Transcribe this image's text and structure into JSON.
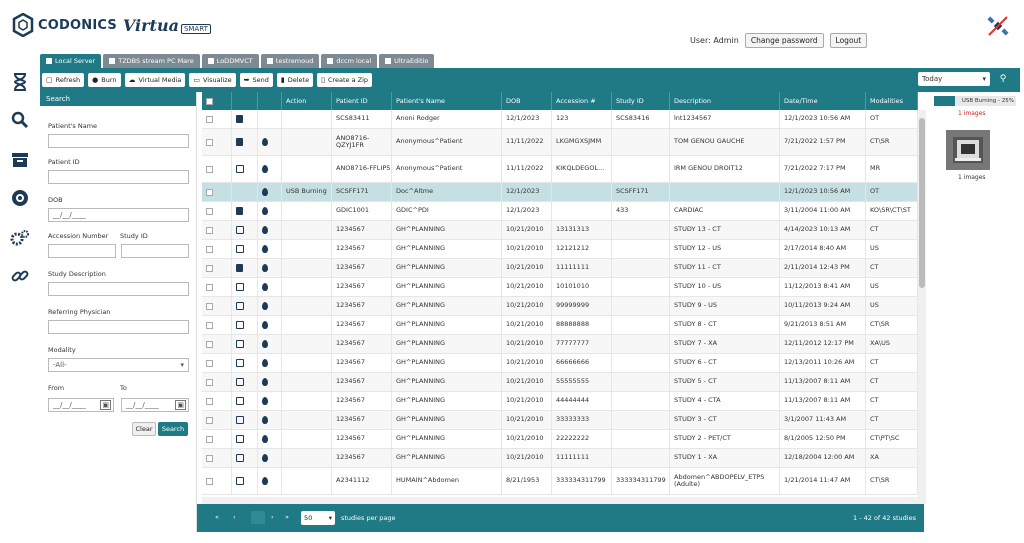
{
  "app": {
    "brand": "CODONICS",
    "product": "Virtua",
    "edition": "SMART"
  },
  "header": {
    "user_label": "User: Admin",
    "change_password": "Change password",
    "logout": "Logout"
  },
  "tabs": [
    {
      "label": "Local Server",
      "active": true
    },
    {
      "label": "TZDBS stream PC Mare",
      "active": false
    },
    {
      "label": "LoDDMVCT",
      "active": false
    },
    {
      "label": "testremoud",
      "active": false
    },
    {
      "label": "dccm local",
      "active": false
    },
    {
      "label": "UltraEditio",
      "active": false
    }
  ],
  "toolbar": {
    "refresh": "Refresh",
    "burn": "Burn",
    "virtual_media": "Virtual Media",
    "visualize": "Visualize",
    "send": "Send",
    "delete": "Delete",
    "create_zip": "Create a Zip",
    "date_filter": "Today"
  },
  "search": {
    "heading": "Search",
    "patient_name_label": "Patient's Name",
    "patient_id_label": "Patient ID",
    "dob_label": "DOB",
    "dob_value": "__/__/____",
    "accession_label": "Accession Number",
    "study_id_label": "Study ID",
    "study_desc_label": "Study Description",
    "ref_phys_label": "Referring Physician",
    "modality_label": "Modality",
    "modality_value": "-All-",
    "from_label": "From",
    "to_label": "To",
    "from_value": "__/__/____",
    "to_value": "__/__/____",
    "clear": "Clear",
    "search_btn": "Search"
  },
  "grid": {
    "columns": [
      "",
      "",
      "",
      "Action",
      "Patient ID",
      "Patient's Name",
      "DOB",
      "Accession #",
      "Study ID",
      "Description",
      "Date/Time",
      "Modalities"
    ],
    "rows": [
      {
        "icon": "doc",
        "drop": false,
        "action": "",
        "pid": "SCS83411",
        "name": "Anoni Rodger",
        "dob": "12/1/2023",
        "acc": "123",
        "sid": "SCS83416",
        "desc": "lnt1234567",
        "dt": "12/1/2023 10:56 AM",
        "mod": "OT"
      },
      {
        "icon": "doc",
        "drop": true,
        "action": "",
        "pid": "ANO8716-QZYJ1FR",
        "name": "Anonymous^Patient",
        "dob": "11/11/2022",
        "acc": "LKGMGXSJMM",
        "sid": "",
        "desc": "TOM GENOU GAUCHE",
        "dt": "7/21/2022 1:57 PM",
        "mod": "CT\\SR"
      },
      {
        "icon": "edit",
        "drop": true,
        "action": "",
        "pid": "ANO8716-FFLIP5",
        "name": "Anonymous^Patient",
        "dob": "11/11/2022",
        "acc": "KIKQLDEGOL...",
        "sid": "",
        "desc": "IRM GENOU DROIT12",
        "dt": "7/21/2022 7:17 PM",
        "mod": "MR"
      },
      {
        "icon": "none",
        "drop": true,
        "action": "USB Burning",
        "pid": "SCSFF171",
        "name": "Doc^Altme",
        "dob": "12/1/2023",
        "acc": "",
        "sid": "SCSFF171",
        "desc": "",
        "dt": "12/1/2023 10:56 AM",
        "mod": "OT",
        "selected": true
      },
      {
        "icon": "check",
        "drop": true,
        "action": "",
        "pid": "GDIC1001",
        "name": "GDIC^PDI",
        "dob": "12/1/2023",
        "acc": "",
        "sid": "433",
        "desc": "CARDIAC",
        "dt": "3/11/2004 11:00 AM",
        "mod": "KO\\SR\\CT\\ST"
      },
      {
        "icon": "edit",
        "drop": true,
        "action": "",
        "pid": "1234567",
        "name": "GH^PLANNING",
        "dob": "10/21/2010",
        "acc": "13131313",
        "sid": "",
        "desc": "STUDY 13 - CT",
        "dt": "4/14/2023 10:13 AM",
        "mod": "CT"
      },
      {
        "icon": "edit",
        "drop": true,
        "action": "",
        "pid": "1234567",
        "name": "GH^PLANNING",
        "dob": "10/21/2010",
        "acc": "12121212",
        "sid": "",
        "desc": "STUDY 12 - US",
        "dt": "2/17/2014 8:40 AM",
        "mod": "US"
      },
      {
        "icon": "check",
        "drop": true,
        "action": "",
        "pid": "1234567",
        "name": "GH^PLANNING",
        "dob": "10/21/2010",
        "acc": "11111111",
        "sid": "",
        "desc": "STUDY 11 - CT",
        "dt": "2/11/2014 12:43 PM",
        "mod": "CT"
      },
      {
        "icon": "edit",
        "drop": true,
        "action": "",
        "pid": "1234567",
        "name": "GH^PLANNING",
        "dob": "10/21/2010",
        "acc": "10101010",
        "sid": "",
        "desc": "STUDY 10 - US",
        "dt": "11/12/2013 8:41 AM",
        "mod": "US"
      },
      {
        "icon": "edit",
        "drop": true,
        "action": "",
        "pid": "1234567",
        "name": "GH^PLANNING",
        "dob": "10/21/2010",
        "acc": "99999999",
        "sid": "",
        "desc": "STUDY 9 - US",
        "dt": "10/11/2013 9:24 AM",
        "mod": "US"
      },
      {
        "icon": "edit",
        "drop": true,
        "action": "",
        "pid": "1234567",
        "name": "GH^PLANNING",
        "dob": "10/21/2010",
        "acc": "88888888",
        "sid": "",
        "desc": "STUDY 8 - CT",
        "dt": "9/21/2013 8:51 AM",
        "mod": "CT\\SR"
      },
      {
        "icon": "edit",
        "drop": true,
        "action": "",
        "pid": "1234567",
        "name": "GH^PLANNING",
        "dob": "10/21/2010",
        "acc": "77777777",
        "sid": "",
        "desc": "STUDY 7 - XA",
        "dt": "12/11/2012 12:17 PM",
        "mod": "XA\\US"
      },
      {
        "icon": "edit",
        "drop": true,
        "action": "",
        "pid": "1234567",
        "name": "GH^PLANNING",
        "dob": "10/21/2010",
        "acc": "66666666",
        "sid": "",
        "desc": "STUDY 6 - CT",
        "dt": "12/13/2011 10:26 AM",
        "mod": "CT"
      },
      {
        "icon": "edit",
        "drop": true,
        "action": "",
        "pid": "1234567",
        "name": "GH^PLANNING",
        "dob": "10/21/2010",
        "acc": "55555555",
        "sid": "",
        "desc": "STUDY 5 - CT",
        "dt": "11/13/2007 8:11 AM",
        "mod": "CT"
      },
      {
        "icon": "edit",
        "drop": true,
        "action": "",
        "pid": "1234567",
        "name": "GH^PLANNING",
        "dob": "10/21/2010",
        "acc": "44444444",
        "sid": "",
        "desc": "STUDY 4 - CTA",
        "dt": "11/13/2007 8:11 AM",
        "mod": "CT"
      },
      {
        "icon": "edit",
        "drop": true,
        "action": "",
        "pid": "1234567",
        "name": "GH^PLANNING",
        "dob": "10/21/2010",
        "acc": "33333333",
        "sid": "",
        "desc": "STUDY 3 - CT",
        "dt": "3/1/2007 11:43 AM",
        "mod": "CT"
      },
      {
        "icon": "edit",
        "drop": true,
        "action": "",
        "pid": "1234567",
        "name": "GH^PLANNING",
        "dob": "10/21/2010",
        "acc": "22222222",
        "sid": "",
        "desc": "STUDY 2 - PET/CT",
        "dt": "8/1/2005 12:50 PM",
        "mod": "CT\\PT\\SC"
      },
      {
        "icon": "edit",
        "drop": true,
        "action": "",
        "pid": "1234567",
        "name": "GH^PLANNING",
        "dob": "10/21/2010",
        "acc": "11111111",
        "sid": "",
        "desc": "STUDY 1 - XA",
        "dt": "12/18/2004 12:00 AM",
        "mod": "XA"
      },
      {
        "icon": "edit",
        "drop": true,
        "action": "",
        "pid": "A2341112",
        "name": "HUMAIN^Abdomen",
        "dob": "8/21/1953",
        "acc": "333334311799",
        "sid": "333334311799",
        "desc": "Abdomen^ABDOPELV_ETPS (Adulte)",
        "dt": "1/21/2014 11:47 AM",
        "mod": "CT\\SR"
      }
    ]
  },
  "pager": {
    "page_size": "50",
    "per_page_label": "studies per page",
    "summary": "1 - 42 of 42 studies"
  },
  "right_panel": {
    "tab_label": "USB Burning - 25%",
    "images_top": "1 images",
    "images_bottom": "1 images",
    "burn_progress": 0.25
  },
  "colors": {
    "teal": "#1f7a86",
    "navy": "#1d3a56",
    "selected_row": "#c6dfe2",
    "red_text": "#cc2222"
  },
  "icons": [
    "hourglass-icon",
    "search-icon",
    "archive-icon",
    "disc-icon",
    "settings-icon",
    "link-icon",
    "satellite-icon"
  ]
}
